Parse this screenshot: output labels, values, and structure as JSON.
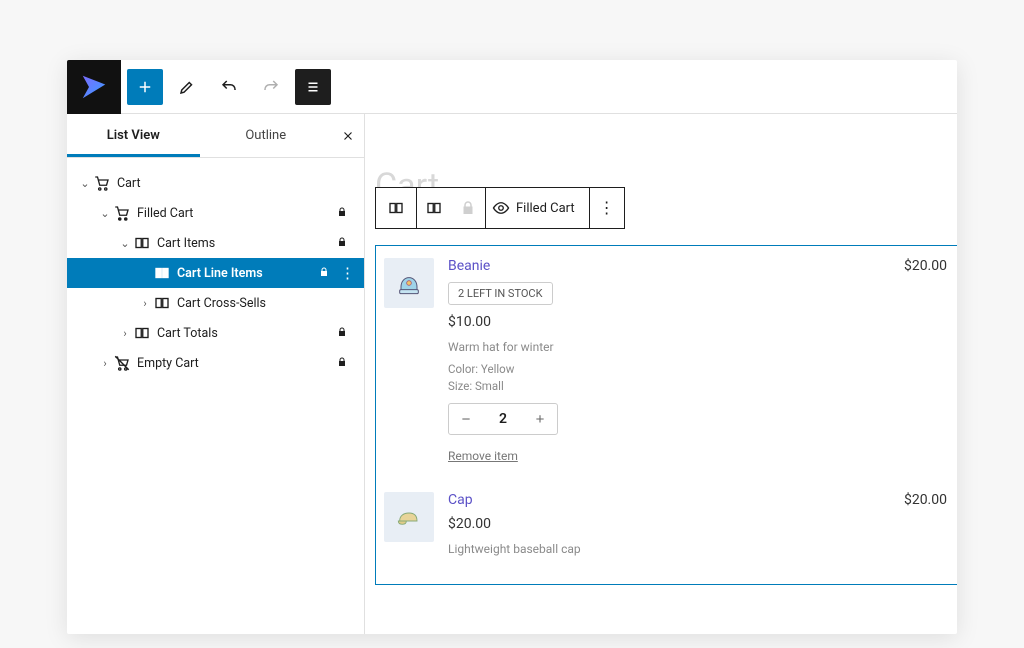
{
  "toolbar": {
    "add_tooltip": "Add block"
  },
  "sidebar": {
    "tabs": {
      "listview": "List View",
      "outline": "Outline"
    },
    "tree": [
      {
        "label": "Cart",
        "icon": "cart",
        "depth": 0,
        "chev": "down",
        "lock": false
      },
      {
        "label": "Filled Cart",
        "icon": "cart-bold",
        "depth": 1,
        "chev": "down",
        "lock": true
      },
      {
        "label": "Cart Items",
        "icon": "cols",
        "depth": 2,
        "chev": "down",
        "lock": true
      },
      {
        "label": "Cart Line Items",
        "icon": "cols",
        "depth": 3,
        "chev": "",
        "lock": true,
        "sel": true
      },
      {
        "label": "Cart Cross-Sells",
        "icon": "cols",
        "depth": 3,
        "chev": "right",
        "lock": false
      },
      {
        "label": "Cart Totals",
        "icon": "cols",
        "depth": 2,
        "chev": "right",
        "lock": true
      },
      {
        "label": "Empty Cart",
        "icon": "cart-off",
        "depth": 1,
        "chev": "right",
        "lock": true
      }
    ]
  },
  "canvas": {
    "ghost_title": "Cart",
    "block_toolbar_label": "Filled Cart"
  },
  "cart": {
    "items": [
      {
        "name": "Beanie",
        "stock_badge": "2 LEFT IN STOCK",
        "price": "$10.00",
        "line_total": "$20.00",
        "desc": "Warm hat for winter",
        "meta1": "Color: Yellow",
        "meta2": "Size: Small",
        "qty": "2",
        "remove": "Remove item",
        "thumb": "beanie"
      },
      {
        "name": "Cap",
        "price": "$20.00",
        "line_total": "$20.00",
        "desc": "Lightweight baseball cap",
        "thumb": "cap"
      }
    ]
  }
}
